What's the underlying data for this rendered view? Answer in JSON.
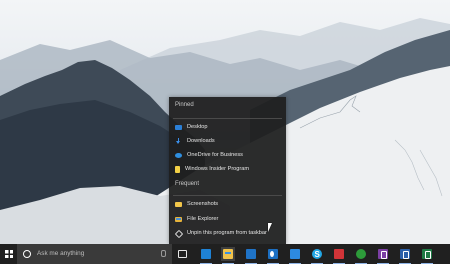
{
  "jumplist": {
    "pinned_header": "Pinned",
    "frequent_header": "Frequent",
    "pinned": [
      {
        "label": "Desktop",
        "icon": "desktop-icon"
      },
      {
        "label": "Downloads",
        "icon": "downloads-icon"
      },
      {
        "label": "OneDrive for Business",
        "icon": "onedrive-icon"
      },
      {
        "label": "Windows Insider Program",
        "icon": "notepad-icon"
      }
    ],
    "frequent": [
      {
        "label": "Screenshots",
        "icon": "folder-icon"
      }
    ],
    "actions": [
      {
        "label": "File Explorer",
        "icon": "file-explorer-icon"
      },
      {
        "label": "Unpin this program from taskbar",
        "icon": "unpin-icon"
      }
    ]
  },
  "taskbar": {
    "search_placeholder": "Ask me anything",
    "icons": [
      "task-view-icon",
      "store-icon",
      "file-explorer-icon",
      "mail-icon",
      "outlook-icon",
      "photos-icon",
      "skype-icon",
      "news-icon",
      "xbox-icon",
      "onenote-icon",
      "word-icon",
      "excel-icon"
    ]
  }
}
